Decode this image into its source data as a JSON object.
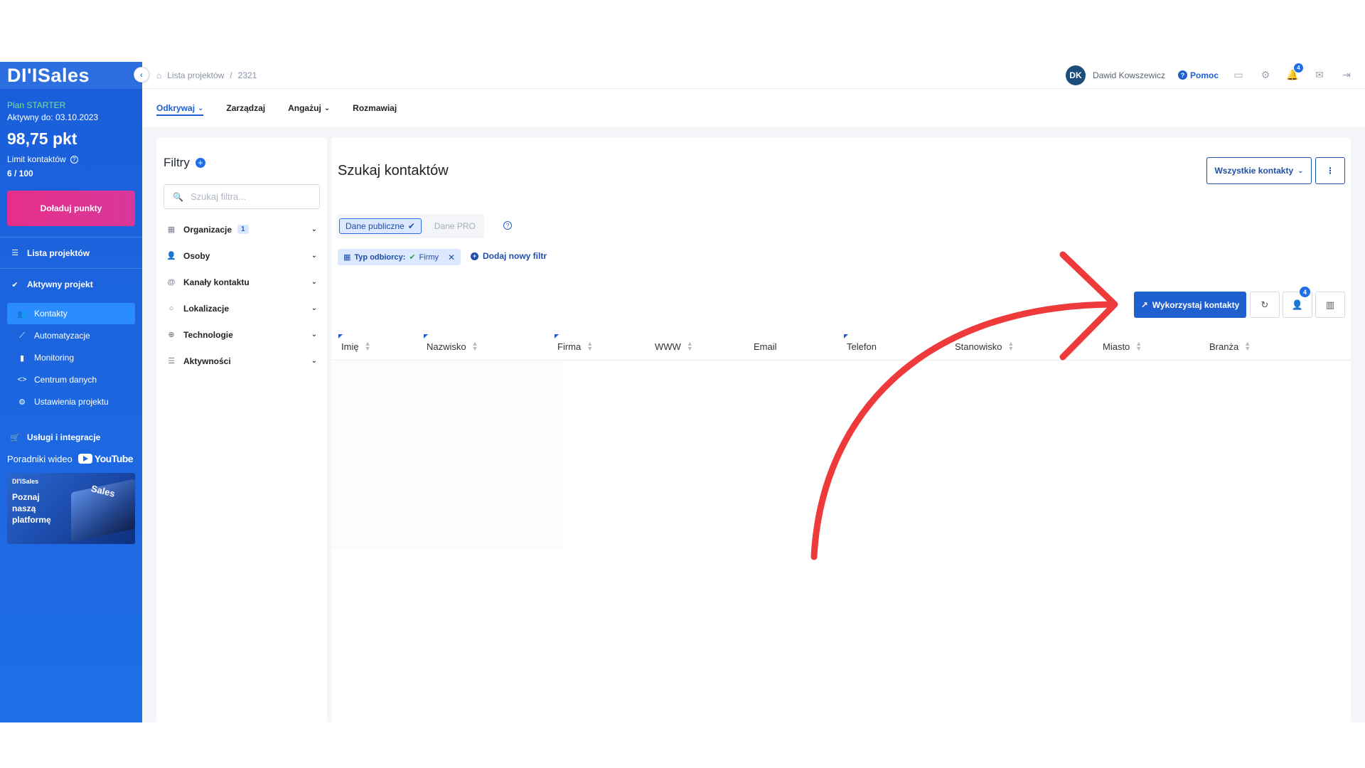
{
  "brand": {
    "logo_text": "DI'ISales"
  },
  "sidebar": {
    "plan_name": "Plan STARTER",
    "active_until": "Aktywny do: 03.10.2023",
    "points": "98,75 pkt",
    "limit_label": "Limit kontaktów",
    "limit_value": "6 / 100",
    "topup_label": "Doładuj punkty",
    "projects_label": "Lista projektów",
    "active_project_label": "Aktywny projekt",
    "items": [
      {
        "label": "Kontakty",
        "icon": "users-icon"
      },
      {
        "label": "Automatyzacje",
        "icon": "trend-icon"
      },
      {
        "label": "Monitoring",
        "icon": "bar-chart-icon"
      },
      {
        "label": "Centrum danych",
        "icon": "code-icon"
      },
      {
        "label": "Ustawienia projektu",
        "icon": "gear-icon"
      }
    ],
    "services_label": "Usługi i integracje",
    "video_label": "Poradniki wideo",
    "youtube_label": "YouTube",
    "promo_brand": "DI'ISales",
    "promo_line1": "Poznaj",
    "promo_line2": "naszą",
    "promo_line3": "platformę",
    "promo_graphic_text": "Sales"
  },
  "topbar": {
    "breadcrumb_root": "Lista projektów",
    "breadcrumb_sep": "/",
    "breadcrumb_current": "2321",
    "user_initials": "DK",
    "user_name": "Dawid Kowszewicz",
    "help_label": "Pomoc",
    "notifications_count": "4"
  },
  "tabs": [
    {
      "label": "Odkrywaj",
      "has_dropdown": true,
      "active": true
    },
    {
      "label": "Zarządzaj",
      "has_dropdown": false
    },
    {
      "label": "Angażuj",
      "has_dropdown": true
    },
    {
      "label": "Rozmawiaj",
      "has_dropdown": false
    }
  ],
  "filters": {
    "title": "Filtry",
    "search_placeholder": "Szukaj filtra...",
    "groups": [
      {
        "label": "Organizacje",
        "count": "1",
        "icon": "building-icon"
      },
      {
        "label": "Osoby",
        "icon": "person-icon"
      },
      {
        "label": "Kanały kontaktu",
        "icon": "at-icon"
      },
      {
        "label": "Lokalizacje",
        "icon": "location-icon"
      },
      {
        "label": "Technologie",
        "icon": "globe-icon"
      },
      {
        "label": "Aktywności",
        "icon": "database-icon"
      }
    ]
  },
  "main": {
    "title": "Szukaj kontaktów",
    "all_contacts_label": "Wszystkie kontakty",
    "data_public_label": "Dane publiczne",
    "data_pro_label": "Dane PRO",
    "chip_label": "Typ odbiorcy:",
    "chip_value": "Firmy",
    "add_filter_label": "Dodaj nowy filtr",
    "use_contacts_label": "Wykorzystaj kontakty",
    "assign_badge": "4",
    "columns": [
      "Imię",
      "Nazwisko",
      "Firma",
      "WWW",
      "Email",
      "Telefon",
      "Stanowisko",
      "Miasto",
      "Branża"
    ]
  },
  "colors": {
    "sidebar": "#1f6ee8",
    "primary": "#1f5fcf",
    "topup": "#e52f8a",
    "annotation_arrow": "#ee3a3a"
  }
}
